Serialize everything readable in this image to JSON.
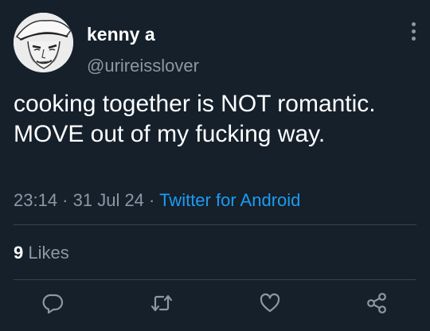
{
  "user": {
    "display_name": "kenny a",
    "handle": "@urireisslover"
  },
  "tweet": {
    "text": "cooking together is NOT romantic. MOVE out of my fucking way.",
    "time": "23:14",
    "date": "31 Jul 24",
    "separator": " · ",
    "source": "Twitter for Android"
  },
  "stats": {
    "likes_count": "9",
    "likes_label": "Likes"
  },
  "icons": {
    "more": "more-vertical-icon",
    "reply": "reply-icon",
    "retweet": "retweet-icon",
    "like": "heart-icon",
    "share": "share-icon"
  },
  "colors": {
    "background": "#15202b",
    "text": "#ffffff",
    "secondary_text": "#8b98a5",
    "link": "#1d9bf0",
    "divider": "#38444d"
  }
}
